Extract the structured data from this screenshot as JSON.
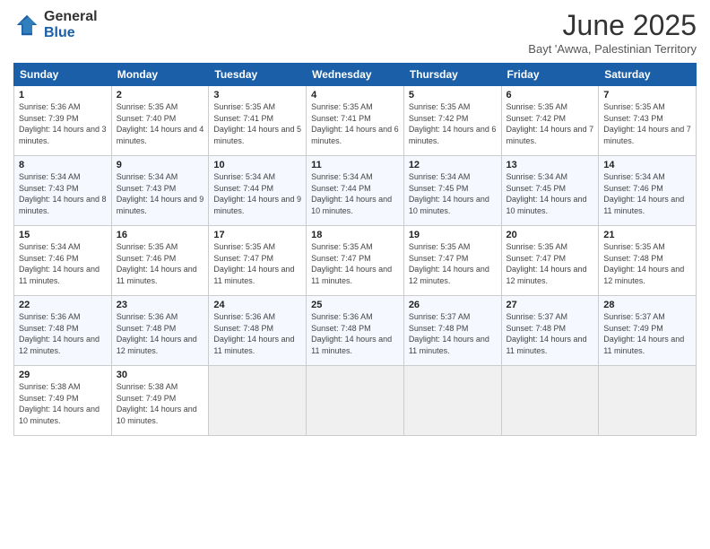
{
  "logo": {
    "general": "General",
    "blue": "Blue"
  },
  "title": "June 2025",
  "subtitle": "Bayt 'Awwa, Palestinian Territory",
  "days": [
    "Sunday",
    "Monday",
    "Tuesday",
    "Wednesday",
    "Thursday",
    "Friday",
    "Saturday"
  ],
  "weeks": [
    [
      {
        "day": "1",
        "sunrise": "Sunrise: 5:36 AM",
        "sunset": "Sunset: 7:39 PM",
        "daylight": "Daylight: 14 hours and 3 minutes."
      },
      {
        "day": "2",
        "sunrise": "Sunrise: 5:35 AM",
        "sunset": "Sunset: 7:40 PM",
        "daylight": "Daylight: 14 hours and 4 minutes."
      },
      {
        "day": "3",
        "sunrise": "Sunrise: 5:35 AM",
        "sunset": "Sunset: 7:41 PM",
        "daylight": "Daylight: 14 hours and 5 minutes."
      },
      {
        "day": "4",
        "sunrise": "Sunrise: 5:35 AM",
        "sunset": "Sunset: 7:41 PM",
        "daylight": "Daylight: 14 hours and 6 minutes."
      },
      {
        "day": "5",
        "sunrise": "Sunrise: 5:35 AM",
        "sunset": "Sunset: 7:42 PM",
        "daylight": "Daylight: 14 hours and 6 minutes."
      },
      {
        "day": "6",
        "sunrise": "Sunrise: 5:35 AM",
        "sunset": "Sunset: 7:42 PM",
        "daylight": "Daylight: 14 hours and 7 minutes."
      },
      {
        "day": "7",
        "sunrise": "Sunrise: 5:35 AM",
        "sunset": "Sunset: 7:43 PM",
        "daylight": "Daylight: 14 hours and 7 minutes."
      }
    ],
    [
      {
        "day": "8",
        "sunrise": "Sunrise: 5:34 AM",
        "sunset": "Sunset: 7:43 PM",
        "daylight": "Daylight: 14 hours and 8 minutes."
      },
      {
        "day": "9",
        "sunrise": "Sunrise: 5:34 AM",
        "sunset": "Sunset: 7:43 PM",
        "daylight": "Daylight: 14 hours and 9 minutes."
      },
      {
        "day": "10",
        "sunrise": "Sunrise: 5:34 AM",
        "sunset": "Sunset: 7:44 PM",
        "daylight": "Daylight: 14 hours and 9 minutes."
      },
      {
        "day": "11",
        "sunrise": "Sunrise: 5:34 AM",
        "sunset": "Sunset: 7:44 PM",
        "daylight": "Daylight: 14 hours and 10 minutes."
      },
      {
        "day": "12",
        "sunrise": "Sunrise: 5:34 AM",
        "sunset": "Sunset: 7:45 PM",
        "daylight": "Daylight: 14 hours and 10 minutes."
      },
      {
        "day": "13",
        "sunrise": "Sunrise: 5:34 AM",
        "sunset": "Sunset: 7:45 PM",
        "daylight": "Daylight: 14 hours and 10 minutes."
      },
      {
        "day": "14",
        "sunrise": "Sunrise: 5:34 AM",
        "sunset": "Sunset: 7:46 PM",
        "daylight": "Daylight: 14 hours and 11 minutes."
      }
    ],
    [
      {
        "day": "15",
        "sunrise": "Sunrise: 5:34 AM",
        "sunset": "Sunset: 7:46 PM",
        "daylight": "Daylight: 14 hours and 11 minutes."
      },
      {
        "day": "16",
        "sunrise": "Sunrise: 5:35 AM",
        "sunset": "Sunset: 7:46 PM",
        "daylight": "Daylight: 14 hours and 11 minutes."
      },
      {
        "day": "17",
        "sunrise": "Sunrise: 5:35 AM",
        "sunset": "Sunset: 7:47 PM",
        "daylight": "Daylight: 14 hours and 11 minutes."
      },
      {
        "day": "18",
        "sunrise": "Sunrise: 5:35 AM",
        "sunset": "Sunset: 7:47 PM",
        "daylight": "Daylight: 14 hours and 11 minutes."
      },
      {
        "day": "19",
        "sunrise": "Sunrise: 5:35 AM",
        "sunset": "Sunset: 7:47 PM",
        "daylight": "Daylight: 14 hours and 12 minutes."
      },
      {
        "day": "20",
        "sunrise": "Sunrise: 5:35 AM",
        "sunset": "Sunset: 7:47 PM",
        "daylight": "Daylight: 14 hours and 12 minutes."
      },
      {
        "day": "21",
        "sunrise": "Sunrise: 5:35 AM",
        "sunset": "Sunset: 7:48 PM",
        "daylight": "Daylight: 14 hours and 12 minutes."
      }
    ],
    [
      {
        "day": "22",
        "sunrise": "Sunrise: 5:36 AM",
        "sunset": "Sunset: 7:48 PM",
        "daylight": "Daylight: 14 hours and 12 minutes."
      },
      {
        "day": "23",
        "sunrise": "Sunrise: 5:36 AM",
        "sunset": "Sunset: 7:48 PM",
        "daylight": "Daylight: 14 hours and 12 minutes."
      },
      {
        "day": "24",
        "sunrise": "Sunrise: 5:36 AM",
        "sunset": "Sunset: 7:48 PM",
        "daylight": "Daylight: 14 hours and 11 minutes."
      },
      {
        "day": "25",
        "sunrise": "Sunrise: 5:36 AM",
        "sunset": "Sunset: 7:48 PM",
        "daylight": "Daylight: 14 hours and 11 minutes."
      },
      {
        "day": "26",
        "sunrise": "Sunrise: 5:37 AM",
        "sunset": "Sunset: 7:48 PM",
        "daylight": "Daylight: 14 hours and 11 minutes."
      },
      {
        "day": "27",
        "sunrise": "Sunrise: 5:37 AM",
        "sunset": "Sunset: 7:48 PM",
        "daylight": "Daylight: 14 hours and 11 minutes."
      },
      {
        "day": "28",
        "sunrise": "Sunrise: 5:37 AM",
        "sunset": "Sunset: 7:49 PM",
        "daylight": "Daylight: 14 hours and 11 minutes."
      }
    ],
    [
      {
        "day": "29",
        "sunrise": "Sunrise: 5:38 AM",
        "sunset": "Sunset: 7:49 PM",
        "daylight": "Daylight: 14 hours and 10 minutes."
      },
      {
        "day": "30",
        "sunrise": "Sunrise: 5:38 AM",
        "sunset": "Sunset: 7:49 PM",
        "daylight": "Daylight: 14 hours and 10 minutes."
      },
      null,
      null,
      null,
      null,
      null
    ]
  ]
}
